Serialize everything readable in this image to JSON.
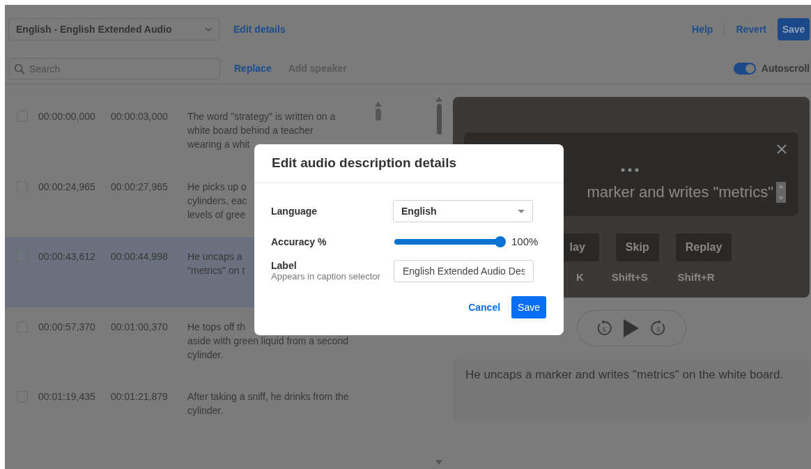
{
  "top_bar": {
    "track_select": {
      "value": "English - English Extended Audio"
    },
    "edit_details": "Edit details",
    "help": "Help",
    "revert": "Revert",
    "save": "Save"
  },
  "toolbar": {
    "search": {
      "placeholder": "Search"
    },
    "replace": "Replace",
    "add_speaker": {
      "label": "Add speaker",
      "disabled": true
    },
    "autoscroll": {
      "label": "Autoscroll",
      "on": true
    }
  },
  "cues": [
    {
      "start": "00:00:00,000",
      "end": "00:00:03,000",
      "lines": [
        "The word \"strategy\" is written on a",
        "white board behind a teacher",
        "wearing a whit"
      ],
      "checked": false,
      "selected": false
    },
    {
      "start": "00:00:24,965",
      "end": "00:00:27,965",
      "lines": [
        "He picks up o",
        "cylinders, eac",
        "levels of gree"
      ],
      "checked": false,
      "selected": false
    },
    {
      "start": "00:00:43,612",
      "end": "00:00:44,998",
      "lines": [
        "He uncaps a",
        "\"metrics\" on t"
      ],
      "checked": false,
      "selected": true
    },
    {
      "start": "00:00:57,370",
      "end": "00:01:00,370",
      "lines": [
        "He tops off th",
        "aside with green liquid from a second",
        "cylinder."
      ],
      "checked": false,
      "selected": false
    },
    {
      "start": "00:01:19,435",
      "end": "00:01:21,879",
      "lines": [
        "After taking a sniff, he drinks from the",
        "cylinder."
      ],
      "checked": false,
      "selected": false
    }
  ],
  "player": {
    "rewind_seconds": "5",
    "forward_seconds": "5",
    "caption": "marker and writes \"metrics\"",
    "controls": [
      {
        "label": "lay",
        "shortcut": "K"
      },
      {
        "label": "Skip",
        "shortcut": "Shift+S"
      },
      {
        "label": "Replay",
        "shortcut": "Shift+R"
      }
    ]
  },
  "description_text": "He uncaps a marker and writes \"metrics\" on the white board.",
  "dialog": {
    "title": "Edit audio description details",
    "language": {
      "label": "Language",
      "value": "English"
    },
    "accuracy": {
      "label": "Accuracy %",
      "level": 1,
      "reading": "100%"
    },
    "label_field": {
      "label": "Label",
      "hint": "Appears in caption selector",
      "value": "English Extended Audio Des"
    },
    "cancel": "Cancel",
    "save": "Save"
  }
}
